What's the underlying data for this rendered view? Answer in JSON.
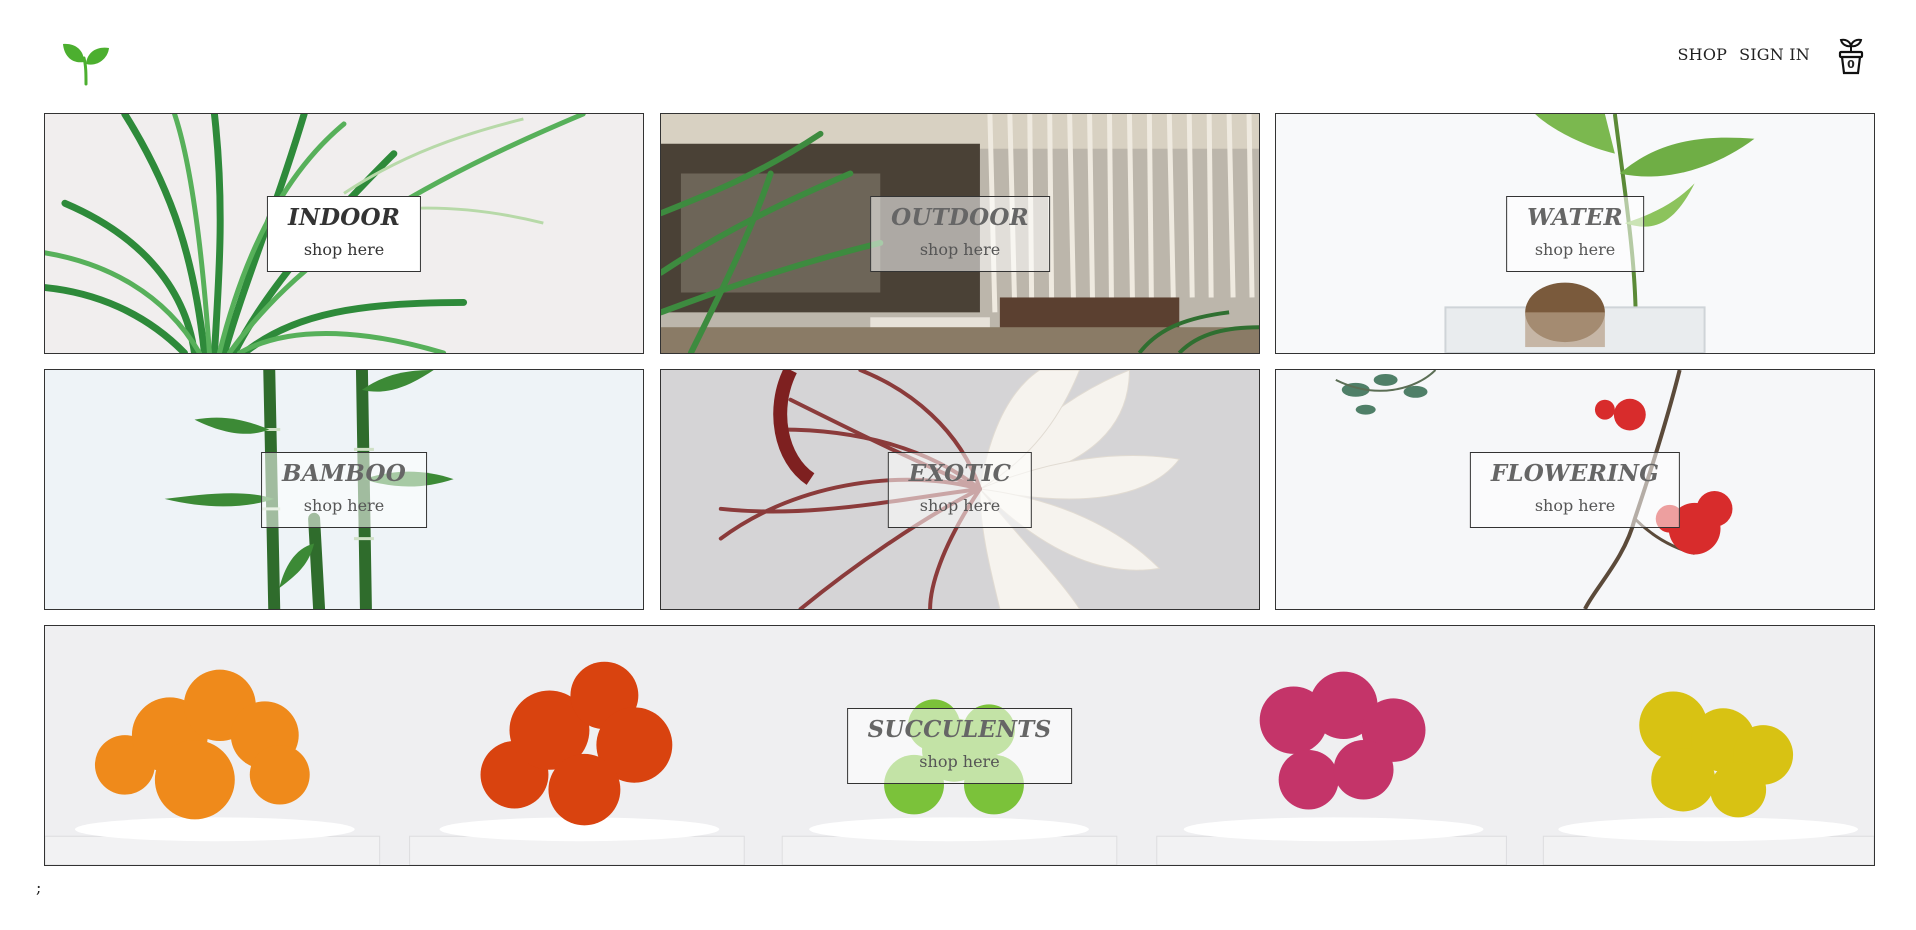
{
  "brand": {
    "logo_icon": "leaf-sprout-icon",
    "logo_color": "#4caf2f"
  },
  "nav": {
    "shop": "SHOP",
    "sign_in": "SIGN IN",
    "cart_icon": "plant-pot-cart-icon",
    "cart_count": "0"
  },
  "categories": [
    {
      "title": "INDOOR",
      "cta": "shop here"
    },
    {
      "title": "OUTDOOR",
      "cta": "shop here"
    },
    {
      "title": "WATER",
      "cta": "shop here"
    },
    {
      "title": "BAMBOO",
      "cta": "shop here"
    },
    {
      "title": "EXOTIC",
      "cta": "shop here"
    },
    {
      "title": "FLOWERING",
      "cta": "shop here"
    },
    {
      "title": "SUCCULENTS",
      "cta": "shop here"
    }
  ],
  "footer_text": ";"
}
